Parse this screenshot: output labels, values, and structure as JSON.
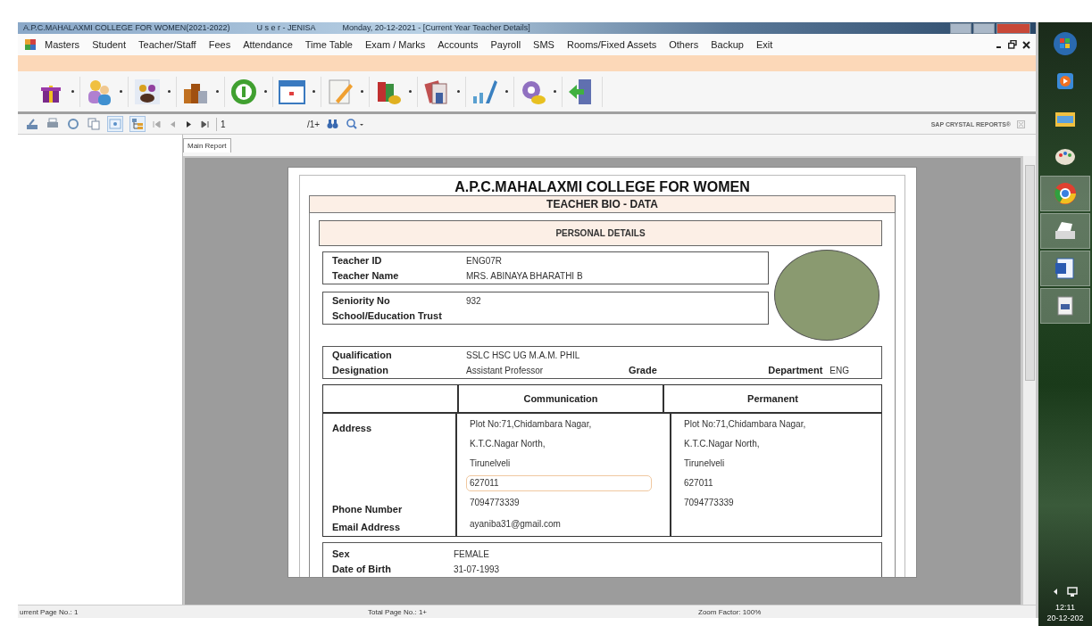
{
  "window": {
    "title": "A.P.C.MAHALAXMI COLLEGE FOR WOMEN(2021-2022)",
    "user": "U s e r - JENISA",
    "date_info": "Monday, 20-12-2021 - [Current Year Teacher Details]"
  },
  "menu": [
    "Masters",
    "Student",
    "Teacher/Staff",
    "Fees",
    "Attendance",
    "Time Table",
    "Exam / Marks",
    "Accounts",
    "Payroll",
    "SMS",
    "Rooms/Fixed Assets",
    "Others",
    "Backup",
    "Exit"
  ],
  "report_toolbar": {
    "page_field": "1",
    "page_count": "/1+",
    "brand": "SAP CRYSTAL REPORTS®"
  },
  "tabs": [
    {
      "label": "Main Report",
      "selected": true
    }
  ],
  "report": {
    "college": "A.P.C.MAHALAXMI COLLEGE FOR WOMEN",
    "title": "TEACHER BIO - DATA",
    "section": "PERSONAL DETAILS",
    "id_fields": [
      {
        "label": "Teacher ID",
        "value": "ENG07R"
      },
      {
        "label": "Teacher Name",
        "value": "MRS. ABINAYA BHARATHI B"
      }
    ],
    "seniority_fields": [
      {
        "label": "Seniority No",
        "value": "932"
      },
      {
        "label": "School/Education Trust"
      }
    ],
    "qualification": {
      "label": "Qualification",
      "value": "SSLC HSC UG M.A.M. PHIL"
    },
    "designation": {
      "label": "Designation",
      "value": "Assistant Professor"
    },
    "grade": {
      "label": "Grade"
    },
    "department": {
      "label": "Department",
      "value": "ENG"
    },
    "address": {
      "columns": [
        "Communication",
        "Permanent"
      ],
      "address_label": "Address",
      "phone_label": "Phone Number",
      "email_label": "Email Address",
      "communication": {
        "lines": [
          {
            "text": "Plot No:71,Chidambara Nagar,",
            "highlighted": false
          },
          {
            "text": "K.T.C.Nagar North,",
            "highlighted": false
          },
          {
            "text": "Tirunelveli",
            "highlighted": false
          },
          {
            "text": "627011",
            "highlighted": true
          }
        ],
        "phone": "7094773339",
        "email": "ayaniba31@gmail.com"
      },
      "permanent": {
        "lines": [
          {
            "text": "Plot No:71,Chidambara Nagar,",
            "highlighted": false
          },
          {
            "text": "K.T.C.Nagar North,",
            "highlighted": false
          },
          {
            "text": "Tirunelveli",
            "highlighted": false
          },
          {
            "text": "627011",
            "highlighted": false
          }
        ],
        "phone": "7094773339"
      }
    },
    "personal": [
      {
        "label": "Sex",
        "value": "FEMALE"
      },
      {
        "label": "Date of Birth",
        "value": "31-07-1993"
      }
    ]
  },
  "status_bar": {
    "current_page": "urrent Page No.: 1",
    "total_pages": "Total Page No.: 1+",
    "zoom": "Zoom Factor: 100%"
  },
  "clock": {
    "time": "12:11",
    "date": "20-12-202"
  }
}
